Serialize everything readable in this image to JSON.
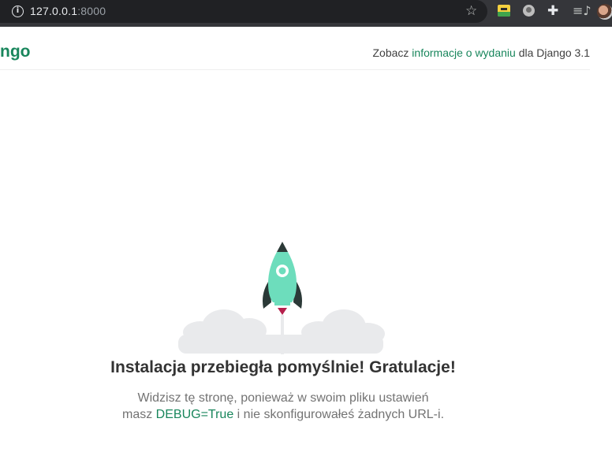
{
  "browser": {
    "url_host": "127.0.0.1",
    "url_port": ":8000",
    "info_icon": "info-icon",
    "bookmark_icon": "star-icon",
    "extensions": [
      "extension-icon",
      "extension-icon",
      "puzzle-icon",
      "playlist-icon"
    ]
  },
  "header": {
    "logo_text": "ngo",
    "release_prefix": "Zobacz ",
    "release_link": "informacje o wydaniu",
    "release_suffix": " dla Django 3.1"
  },
  "main": {
    "title": "Instalacja przebiegła pomyślnie! Gratulacje!",
    "desc_1": "Widzisz tę stronę, ponieważ w swoim pliku ustawień masz ",
    "desc_code": "DEBUG=True",
    "desc_2": " i nie skonfigurowałeś żadnych URL-i."
  },
  "colors": {
    "accent": "#19865c",
    "rocket_body": "#6dddbc",
    "rocket_fins": "#2b3937",
    "flame": "#b5204c",
    "clouds": "#e9eaec"
  }
}
